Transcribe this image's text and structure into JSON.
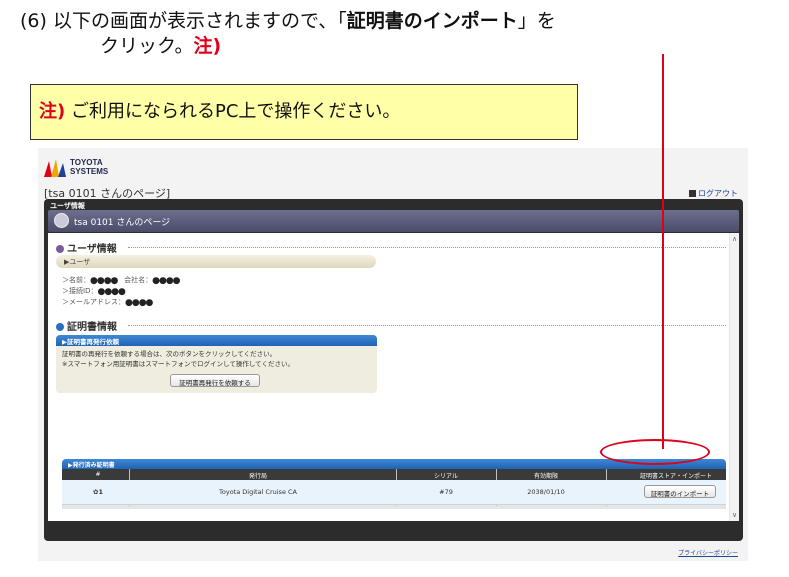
{
  "instruction": {
    "line1_prefix": "(6) 以下の画面が表示されますので、「",
    "line1_strong": "証明書のインポート",
    "line1_suffix": "」を",
    "line2_text": "クリック。",
    "line2_note": "注)"
  },
  "note_box": {
    "label": "注)",
    "text": "ご利用になられるPC上で操作ください。"
  },
  "colors": {
    "accent_red": "#e0001b",
    "header_blue": "#1f63b3",
    "note_bg": "#ffffa8"
  },
  "portal": {
    "logo": {
      "line1": "TOYOTA",
      "line2": "SYSTEMS"
    },
    "page_heading": "[tsa 0101 さんのページ]",
    "logout": "ログアウト",
    "window_tab": "ユーザ情報",
    "window_title": "tsa 0101 さんのページ",
    "user_section": {
      "title": "ユーザ情報",
      "pill": "▶ユーザ",
      "name_label": "＞名前：",
      "name_mask": "●●●●",
      "company_label": "会社名：",
      "company_mask": "●●●●",
      "login_label": "＞接続ID：",
      "login_mask": "●●●●",
      "email_label": "＞メールアドレス：",
      "email_mask": "●●●●"
    },
    "cert_section": {
      "title": "証明書情報",
      "reissue_header": "▶証明書再発行依頼",
      "reissue_line1": "証明書の再発行を依頼する場合は、次のボタンをクリックしてください。",
      "reissue_line2": "※スマートフォン用証明書はスマートフォンでログインして操作してください。",
      "reissue_button": "証明書再発行を依頼する"
    },
    "issued": {
      "header": "▶発行済み証明書",
      "columns": [
        "#",
        "発行局",
        "シリアル",
        "有効期限",
        "証明書ストア・インポート"
      ],
      "row": {
        "num": "1",
        "issuer": "Toyota Digital Cruise CA",
        "serial": "#79",
        "expiry": "2038/01/10",
        "import_button": "証明書のインポート"
      }
    },
    "privacy": "プライバシーポリシー"
  }
}
